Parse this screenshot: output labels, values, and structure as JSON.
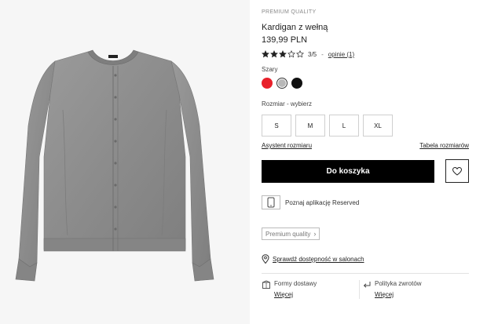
{
  "product": {
    "kicker": "PREMIUM QUALITY",
    "title": "Kardigan z wełną",
    "price": "139,99 PLN",
    "image_label": "Szary kardigan z wełną"
  },
  "rating": {
    "value": 3,
    "max": 5,
    "text": "3/5",
    "separator": "-",
    "reviews": "opinie (1)"
  },
  "color": {
    "label": "Szary",
    "swatches": [
      {
        "name": "red",
        "hex": "#e8202a",
        "selected": false
      },
      {
        "name": "grey",
        "hex": "#b8b8b8",
        "selected": true
      },
      {
        "name": "black",
        "hex": "#111111",
        "selected": false
      }
    ]
  },
  "size": {
    "label": "Rozmiar -  wybierz",
    "options": [
      "S",
      "M",
      "L",
      "XL"
    ]
  },
  "links": {
    "size_assistant": "Asystent rozmiaru",
    "size_table": "Tabela rozmiarów"
  },
  "actions": {
    "add_to_cart": "Do koszyka"
  },
  "app_promo": "Poznaj aplikację Reserved",
  "badge": "Premium quality",
  "store_check": "Sprawdź dostępność w salonach",
  "delivery": {
    "title": "Formy dostawy",
    "more": "Więcej"
  },
  "returns": {
    "title": "Polityka zwrotów",
    "more": "Więcej"
  },
  "colors": {
    "cta_bg": "#000000",
    "sweater": "#8e8e8e",
    "background": "#f6f6f6"
  }
}
